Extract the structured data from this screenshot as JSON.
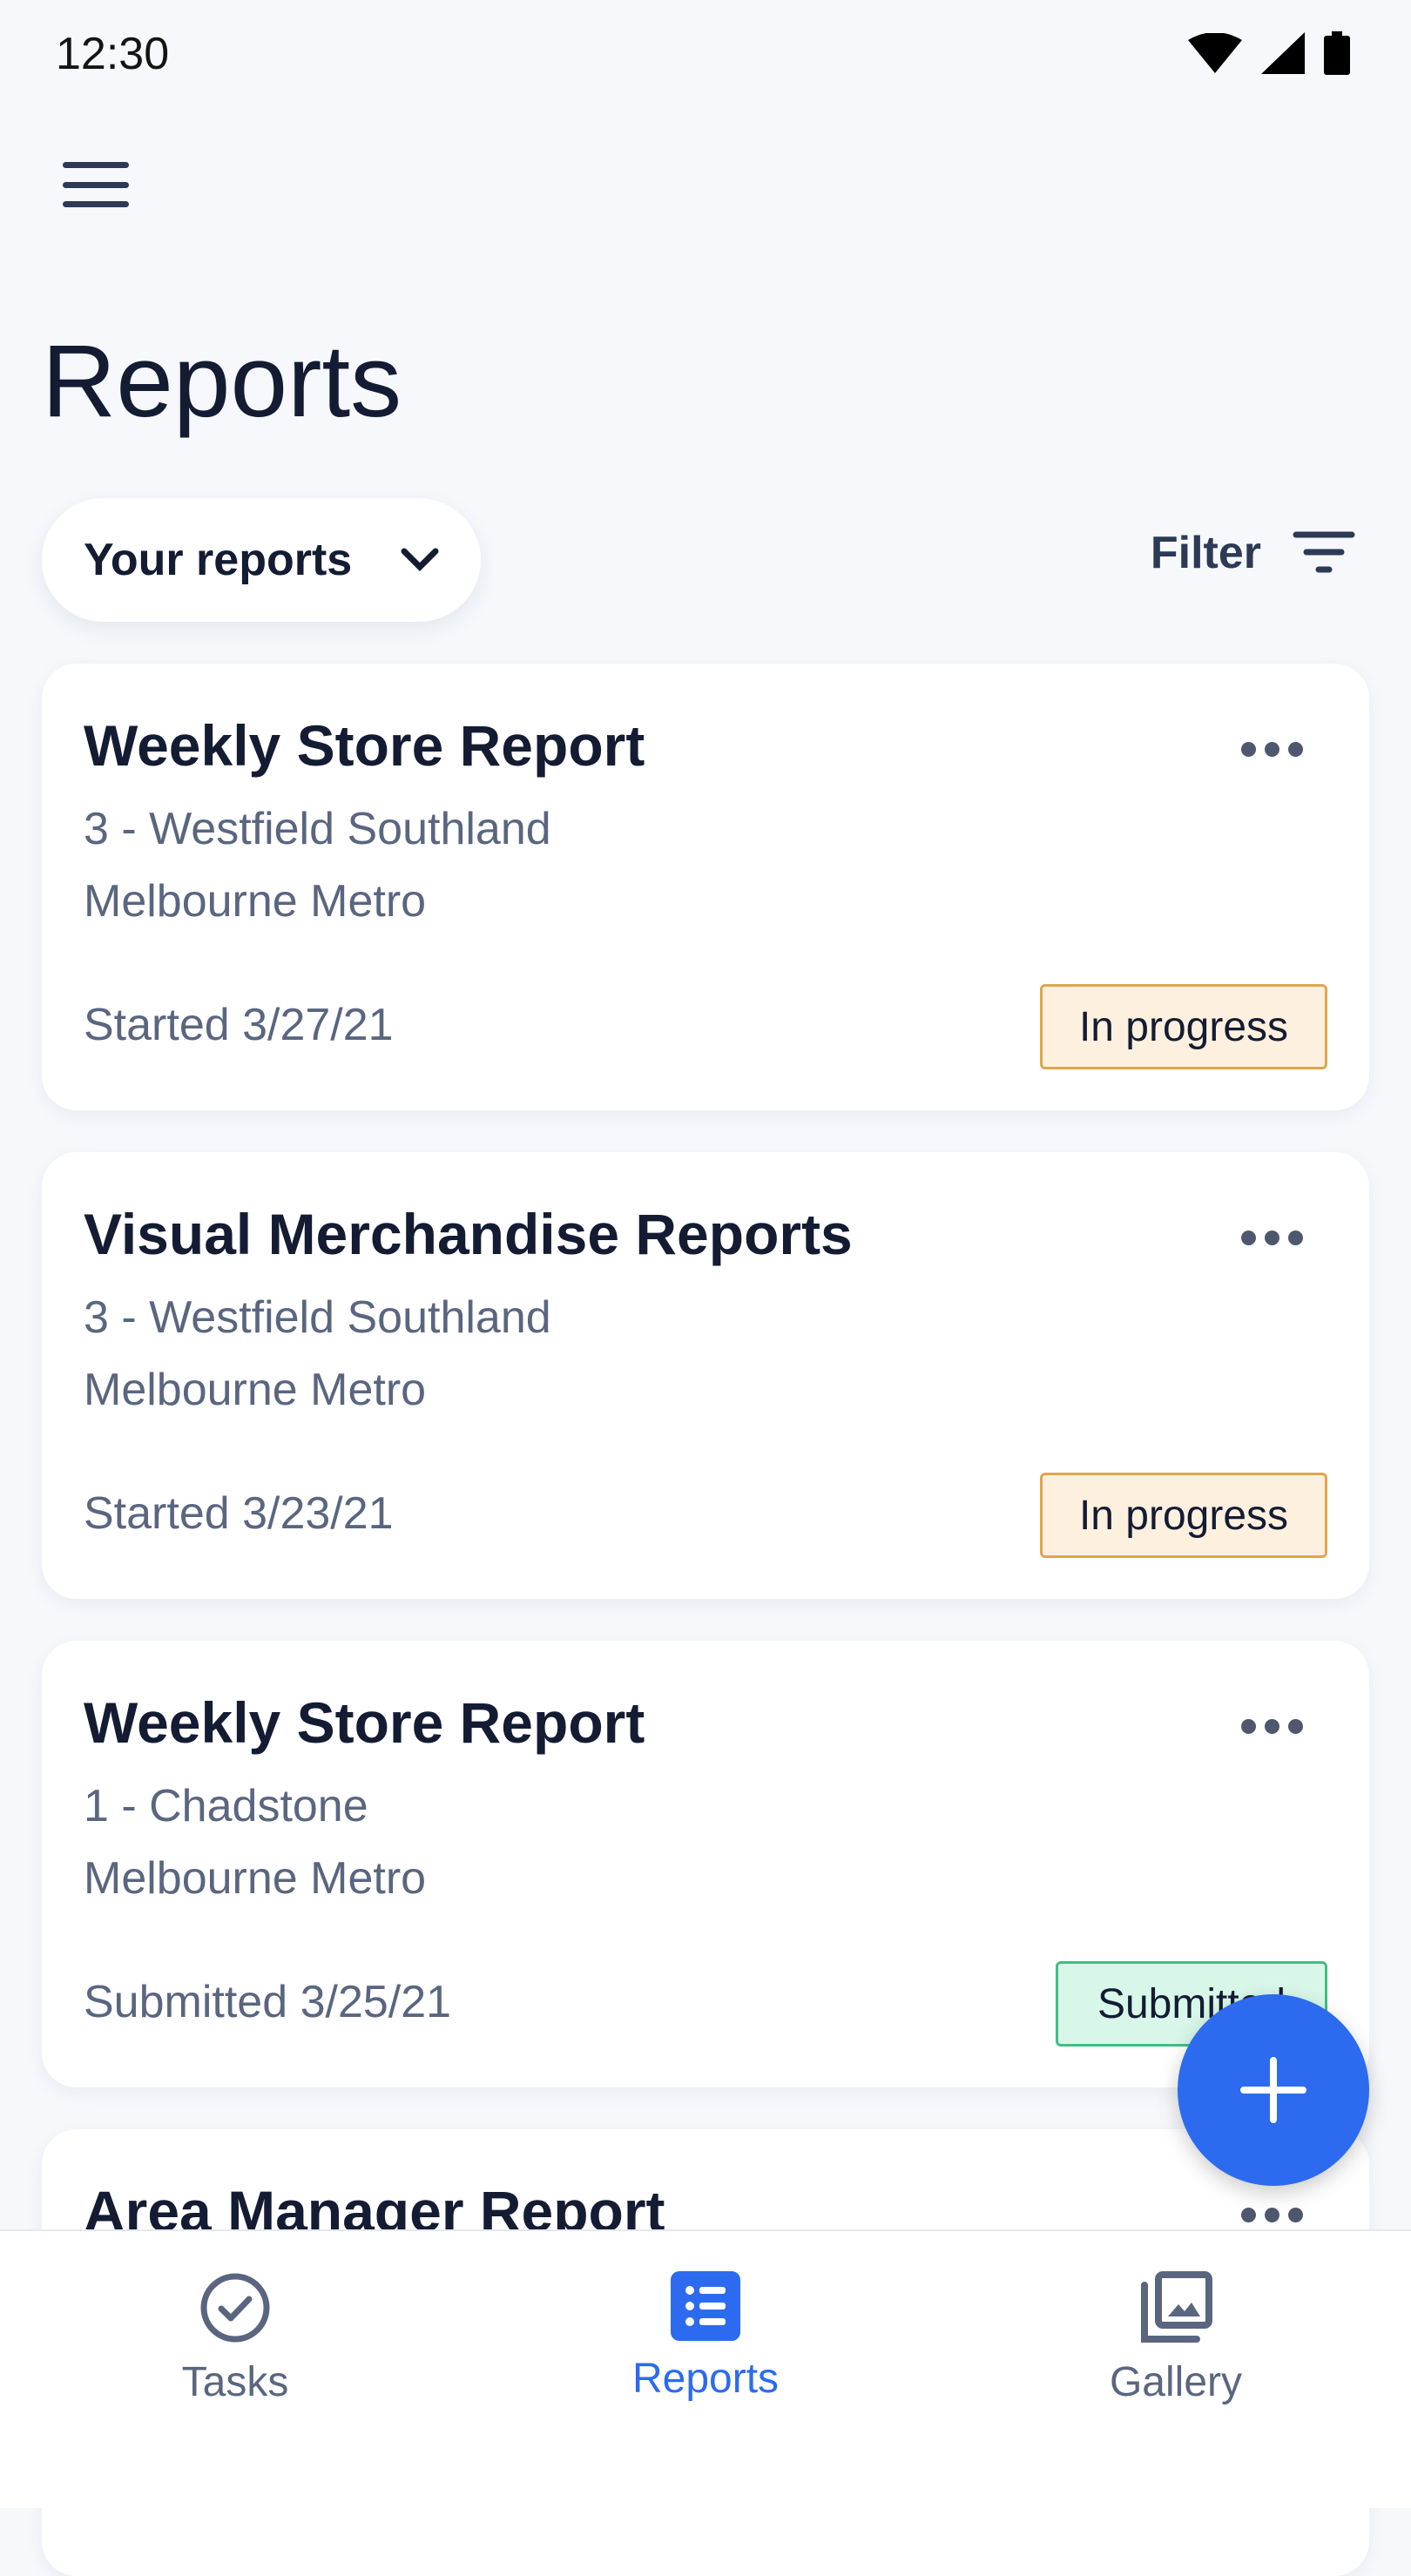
{
  "status_bar": {
    "time": "12:30"
  },
  "header": {
    "title": "Reports",
    "scope_selector": "Your reports",
    "filter_label": "Filter"
  },
  "reports": [
    {
      "title": "Weekly Store Report",
      "store": "3 - Westfield Southland",
      "region": "Melbourne Metro",
      "date": "Started 3/27/21",
      "status": "In progress"
    },
    {
      "title": "Visual Merchandise Reports",
      "store": "3 - Westfield Southland",
      "region": "Melbourne Metro",
      "date": "Started 3/23/21",
      "status": "In progress"
    },
    {
      "title": "Weekly Store Report",
      "store": "1 - Chadstone",
      "region": "Melbourne Metro",
      "date": "Submitted 3/25/21",
      "status": "Submitted"
    },
    {
      "title": "Area Manager Report"
    }
  ],
  "bottom_nav": [
    {
      "label": "Tasks",
      "icon": "check-circle-icon"
    },
    {
      "label": "Reports",
      "icon": "list-icon",
      "active": true
    },
    {
      "label": "Gallery",
      "icon": "gallery-icon"
    }
  ],
  "colors": {
    "accent": "#2c6bef",
    "in_progress_bg": "#fdf0df",
    "submitted_bg": "#d8f7e8",
    "text": "#141c33",
    "muted": "#5a6680"
  }
}
